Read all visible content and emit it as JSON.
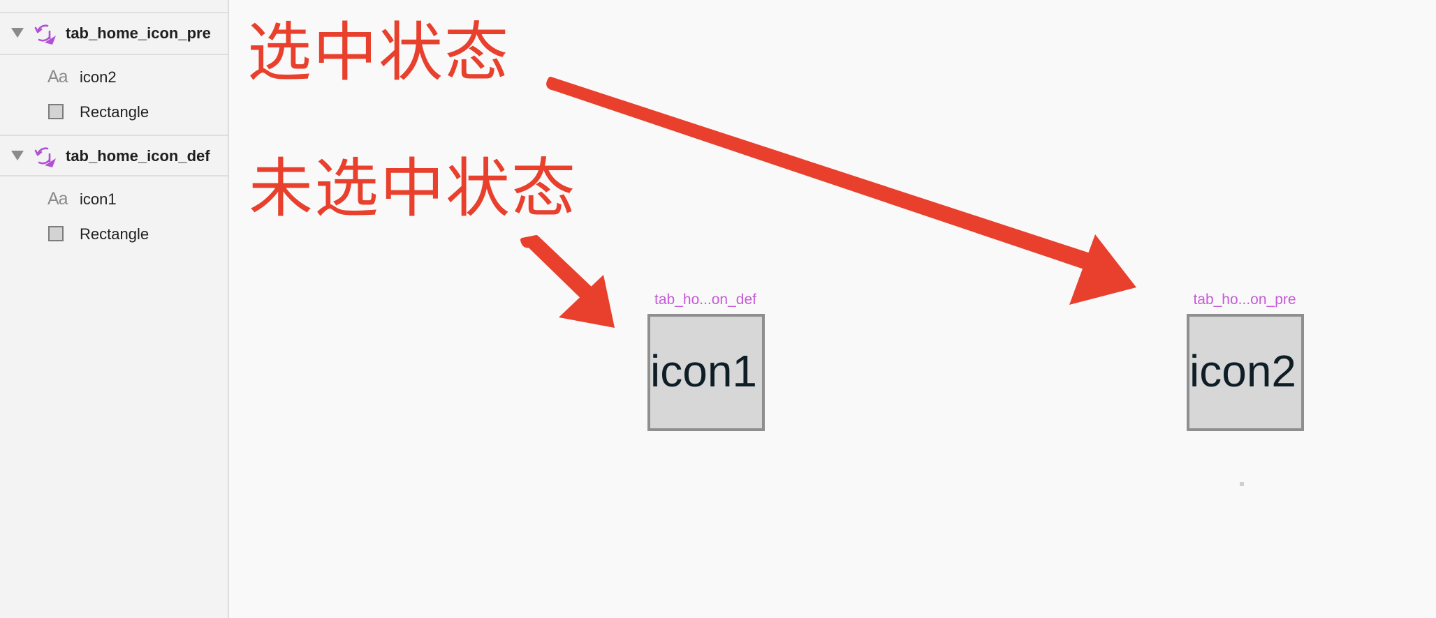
{
  "sidebar": {
    "groups": [
      {
        "label": "tab_home_icon_pre",
        "icon": "symbol-icon",
        "expanded": true,
        "layers": [
          {
            "kind": "text",
            "icon": "text-layer-icon",
            "icon_glyph": "Aa",
            "label": "icon2"
          },
          {
            "kind": "rect",
            "icon": "rectangle-layer-icon",
            "label": "Rectangle"
          }
        ]
      },
      {
        "label": "tab_home_icon_def",
        "icon": "symbol-icon",
        "expanded": true,
        "layers": [
          {
            "kind": "text",
            "icon": "text-layer-icon",
            "icon_glyph": "Aa",
            "label": "icon1"
          },
          {
            "kind": "rect",
            "icon": "rectangle-layer-icon",
            "label": "Rectangle"
          }
        ]
      }
    ]
  },
  "canvas": {
    "annotations": {
      "selected_state": "选中状态",
      "unselected_state": "未选中状态",
      "color": "#e8402c"
    },
    "artboards": [
      {
        "title": "tab_ho...on_def",
        "content": "icon1"
      },
      {
        "title": "tab_ho...on_pre",
        "content": "icon2"
      }
    ],
    "artboard_title_color": "#c55ad8",
    "symbol_color": "#b14fd6"
  }
}
